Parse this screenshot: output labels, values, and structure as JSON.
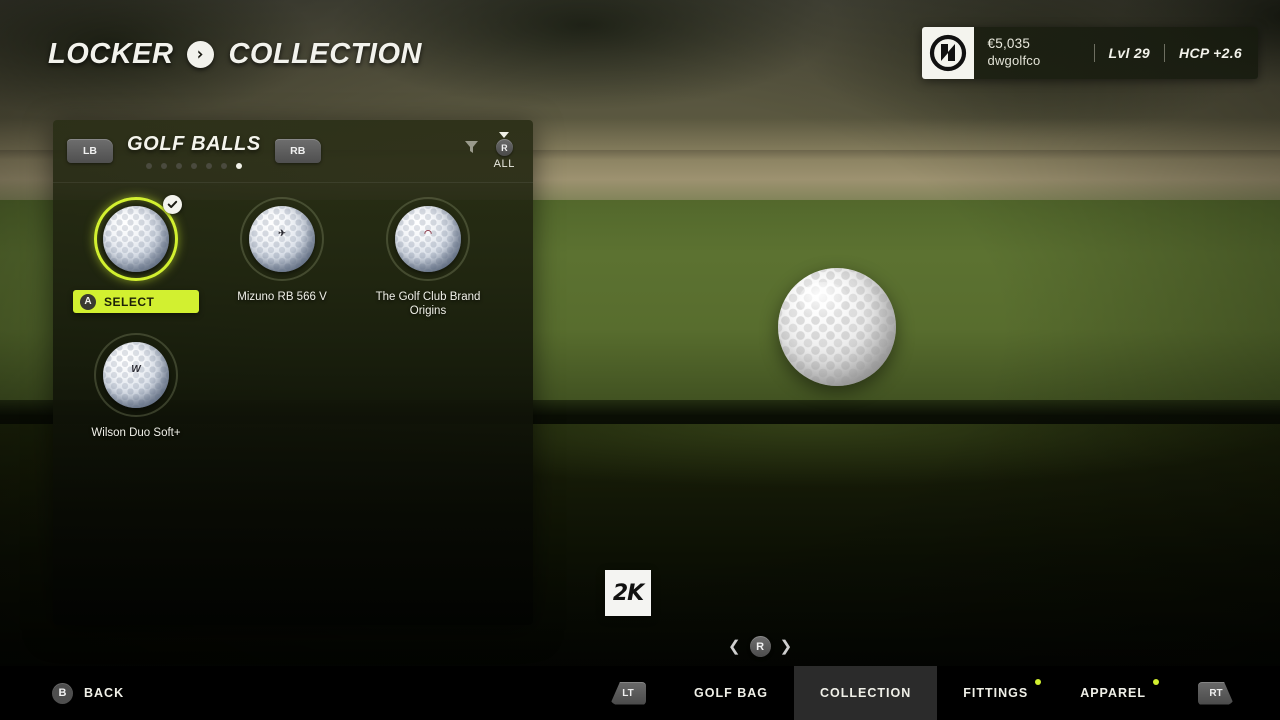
{
  "header": {
    "breadcrumb": [
      "LOCKER",
      "COLLECTION"
    ],
    "separator_icon": "chevron-right-icon"
  },
  "player_hud": {
    "logo_icon": "brand-logo-icon",
    "currency": "€5,035",
    "username": "dwgolfco",
    "level": "Lvl 29",
    "handicap": "HCP +2.6"
  },
  "panel": {
    "title": "GOLF BALLS",
    "prev_bumper": "LB",
    "next_bumper": "RB",
    "page_count": 7,
    "active_page": 7,
    "filter_icon": "funnel-filter-icon",
    "filter_stick": "R",
    "filter_label": "ALL",
    "items": [
      {
        "name": "",
        "selected": true,
        "checked": true,
        "ball_logo": "",
        "action": {
          "button": "A",
          "label": "SELECT"
        }
      },
      {
        "name": "Mizuno RB 566 V",
        "selected": false,
        "checked": false,
        "ball_logo": "✈"
      },
      {
        "name": "The Golf Club Brand Origins",
        "selected": false,
        "checked": false,
        "ball_logo": "◠"
      },
      {
        "name": "Wilson Duo Soft+",
        "selected": false,
        "checked": false,
        "ball_logo": "W"
      }
    ]
  },
  "viewer": {
    "rotate_left_icon": "chevron-left-icon",
    "rotate_stick": "R",
    "rotate_right_icon": "chevron-right-icon",
    "brand_logo": "2K"
  },
  "bottom_bar": {
    "back": {
      "button": "B",
      "label": "BACK"
    },
    "left_trigger": "LT",
    "right_trigger": "RT",
    "tabs": [
      {
        "label": "GOLF BAG",
        "active": false,
        "dot": false
      },
      {
        "label": "COLLECTION",
        "active": true,
        "dot": false
      },
      {
        "label": "FITTINGS",
        "active": false,
        "dot": true
      },
      {
        "label": "APPAREL",
        "active": false,
        "dot": true
      }
    ]
  },
  "colors": {
    "accent": "#d2f030",
    "panel_bg": "#232712",
    "text": "#f0f0e8"
  }
}
